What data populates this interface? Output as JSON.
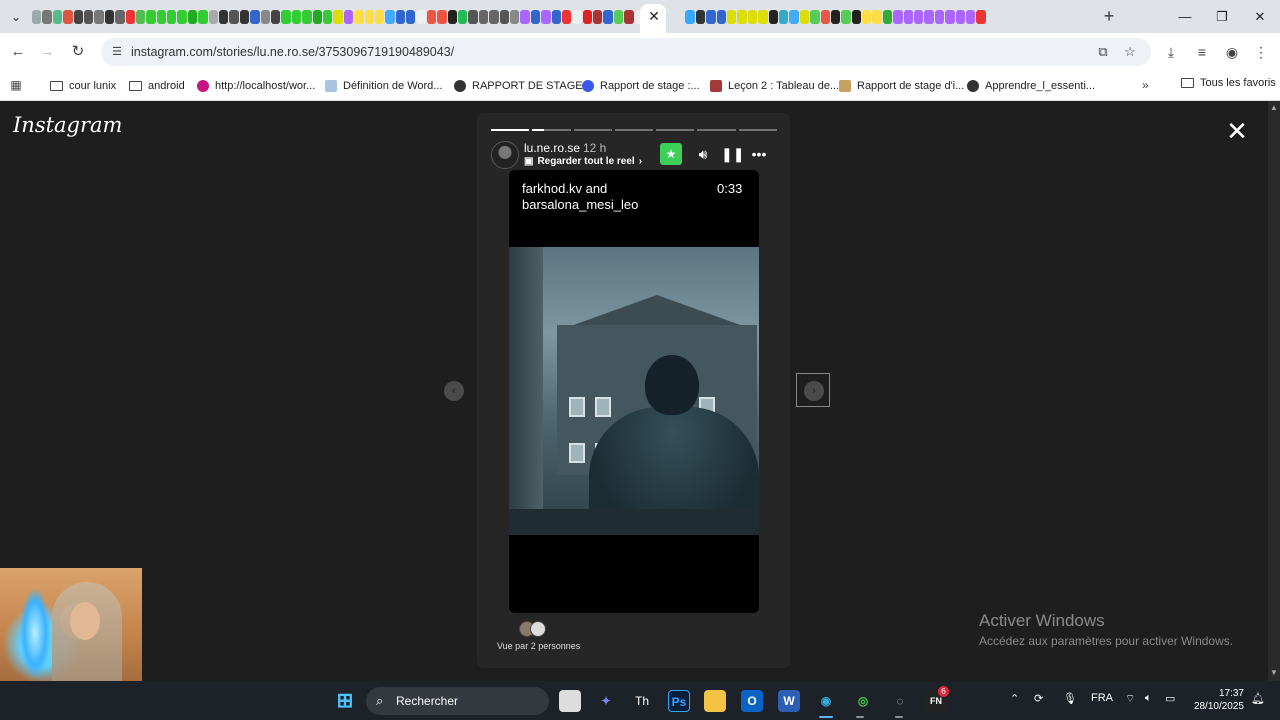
{
  "browser": {
    "url": "instagram.com/stories/lu.ne.ro.se/3753096719190489043/",
    "tab_favicon_colors": [
      "#9aa",
      "#777",
      "#5b8",
      "#d54",
      "#444",
      "#555",
      "#777",
      "#333",
      "#666",
      "#e33",
      "#5b5",
      "#3c3",
      "#3c3",
      "#3c3",
      "#3c3",
      "#2a2",
      "#3c3",
      "#aaa",
      "#333",
      "#555",
      "#333",
      "#36c",
      "#888",
      "#444",
      "#3c3",
      "#3c3",
      "#3c3",
      "#2a2",
      "#3c3",
      "#dd0",
      "#a6f",
      "#fd4",
      "#fd4",
      "#fd4",
      "#4af",
      "#36c",
      "#36c",
      "#eee",
      "#e54",
      "#e54",
      "#222",
      "#2b5",
      "#555",
      "#666",
      "#666",
      "#555",
      "#888",
      "#a6f",
      "#36c",
      "#a6f",
      "#36c",
      "#e33",
      "#eee",
      "#d22",
      "#a33",
      "#36c",
      "#5c5",
      "#a33",
      "#eee",
      "#333",
      "#3af",
      "#333",
      "#36c",
      "#36c",
      "#dd0",
      "#dd0",
      "#dd0",
      "#dd0",
      "#222",
      "#3ac",
      "#4af",
      "#dd0",
      "#5c5",
      "#e54",
      "#222",
      "#5c5",
      "#222",
      "#fd4",
      "#fd4",
      "#3a3",
      "#a6f",
      "#a6f",
      "#a6f",
      "#a6f",
      "#a6f",
      "#a6f",
      "#a6f",
      "#a6f",
      "#e33"
    ]
  },
  "bookmarks": {
    "items": [
      {
        "label": "cour lunix",
        "icon": "folder-icon"
      },
      {
        "label": "android",
        "icon": "folder-icon"
      },
      {
        "label": "http://localhost/wor...",
        "icon": "wordpress-icon",
        "color": "#c4167e"
      },
      {
        "label": "Définition de Word...",
        "icon": "page-icon",
        "color": "#a8c4e0"
      },
      {
        "label": "RAPPORT DE STAGE...",
        "icon": "globe-icon",
        "color": "#333333"
      },
      {
        "label": "Rapport de stage :...",
        "icon": "wordpress-icon",
        "color": "#3858e9"
      },
      {
        "label": "Leçon 2 : Tableau de...",
        "icon": "app-icon",
        "color": "#a33a3a"
      },
      {
        "label": "Rapport de stage d'i...",
        "icon": "page-icon",
        "color": "#c8a060"
      },
      {
        "label": "Apprendre_l_essenti...",
        "icon": "globe-icon",
        "color": "#333333"
      }
    ],
    "all_favorites": "Tous les favoris"
  },
  "instagram": {
    "logo": "Instagram",
    "story": {
      "username": "lu.ne.ro.se",
      "time": "12 h",
      "reel_link": "Regarder tout le reel",
      "segments": 7,
      "progress_fraction_current": 0.3,
      "media_title": "farkhod.kv and barsalona_mesi_leo",
      "media_duration": "0:33",
      "viewed_by": "Vue par 2 personnes"
    }
  },
  "windows": {
    "activate_title": "Activer Windows",
    "activate_sub": "Accédez aux paramètres pour activer Windows."
  },
  "taskbar": {
    "search_placeholder": "Rechercher",
    "language": "FRA",
    "time": "17:37",
    "date": "28/10/2025",
    "notification_count": "6"
  }
}
